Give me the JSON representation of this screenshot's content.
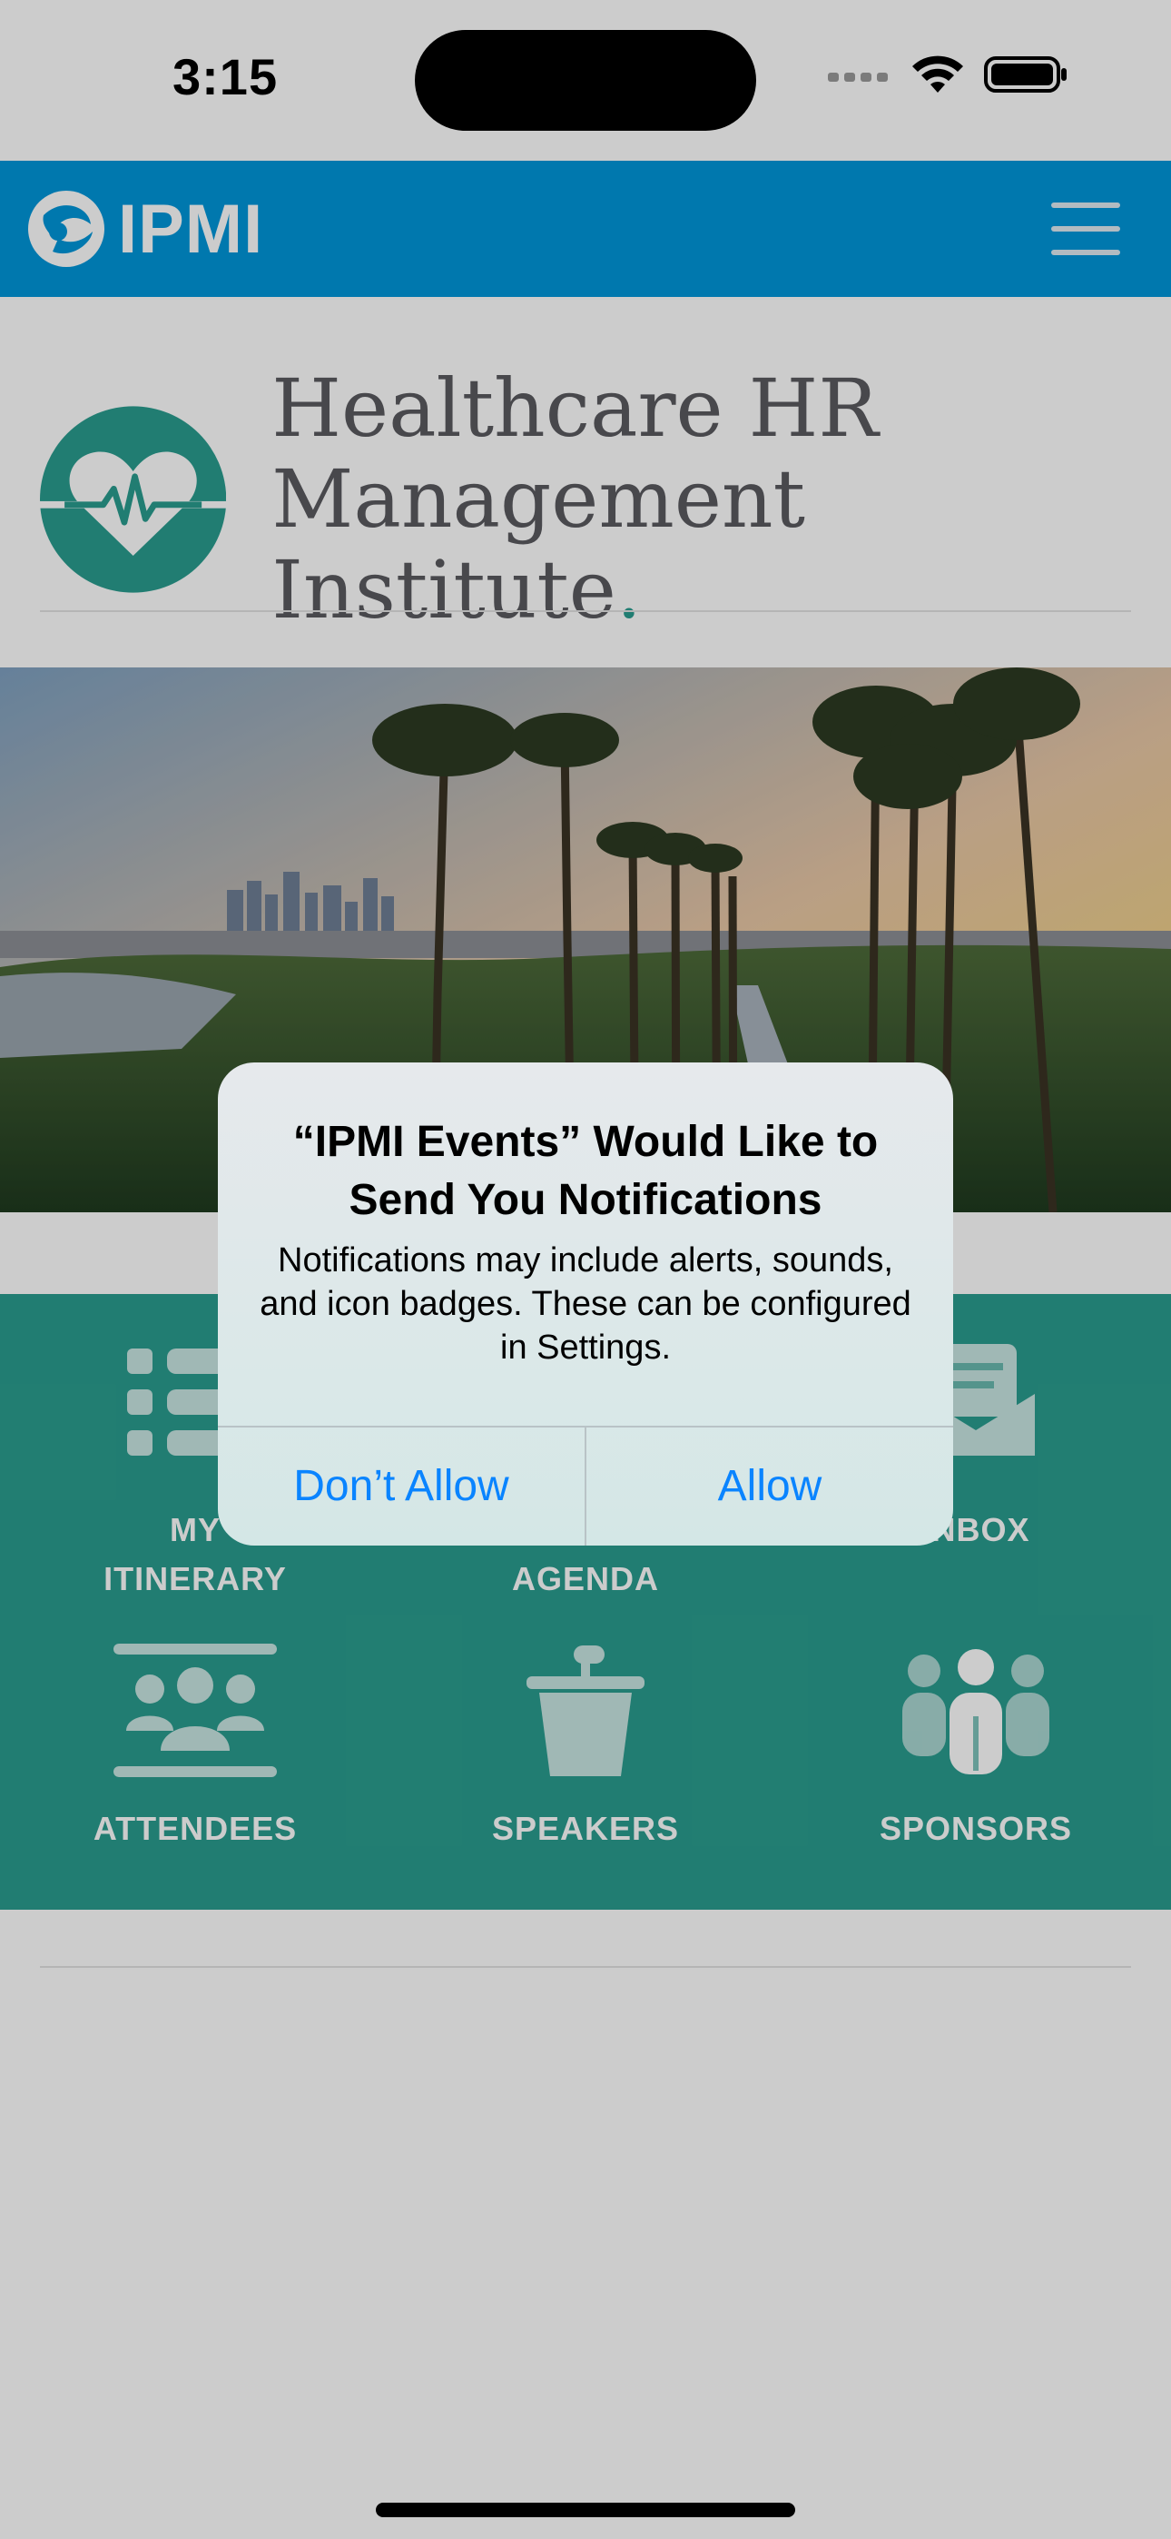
{
  "status_bar": {
    "time": "3:15"
  },
  "navbar": {
    "logo_text": "IPMI"
  },
  "brand": {
    "line1": "Healthcare HR",
    "line2": "Management Institute",
    "dot": "."
  },
  "tiles": [
    {
      "label_line1": "MY",
      "label_line2": "ITINERARY",
      "icon": "list-icon"
    },
    {
      "label_line1": "",
      "label_line2": "AGENDA",
      "icon": "calendar-icon"
    },
    {
      "label_line1": "INBOX",
      "label_line2": "",
      "icon": "envelope-icon"
    },
    {
      "label_line1": "ATTENDEES",
      "label_line2": "",
      "icon": "people-group-icon"
    },
    {
      "label_line1": "SPEAKERS",
      "label_line2": "",
      "icon": "podium-icon"
    },
    {
      "label_line1": "SPONSORS",
      "label_line2": "",
      "icon": "sponsors-icon"
    }
  ],
  "alert": {
    "title": "“IPMI Events” Would Like to Send You Notifications",
    "message": "Notifications may include alerts, sounds, and icon badges. These can be configured in Settings.",
    "deny_label": "Don’t Allow",
    "allow_label": "Allow"
  },
  "colors": {
    "nav": "#0096da",
    "teal": "#2a9d8f",
    "link": "#0a84ff"
  }
}
